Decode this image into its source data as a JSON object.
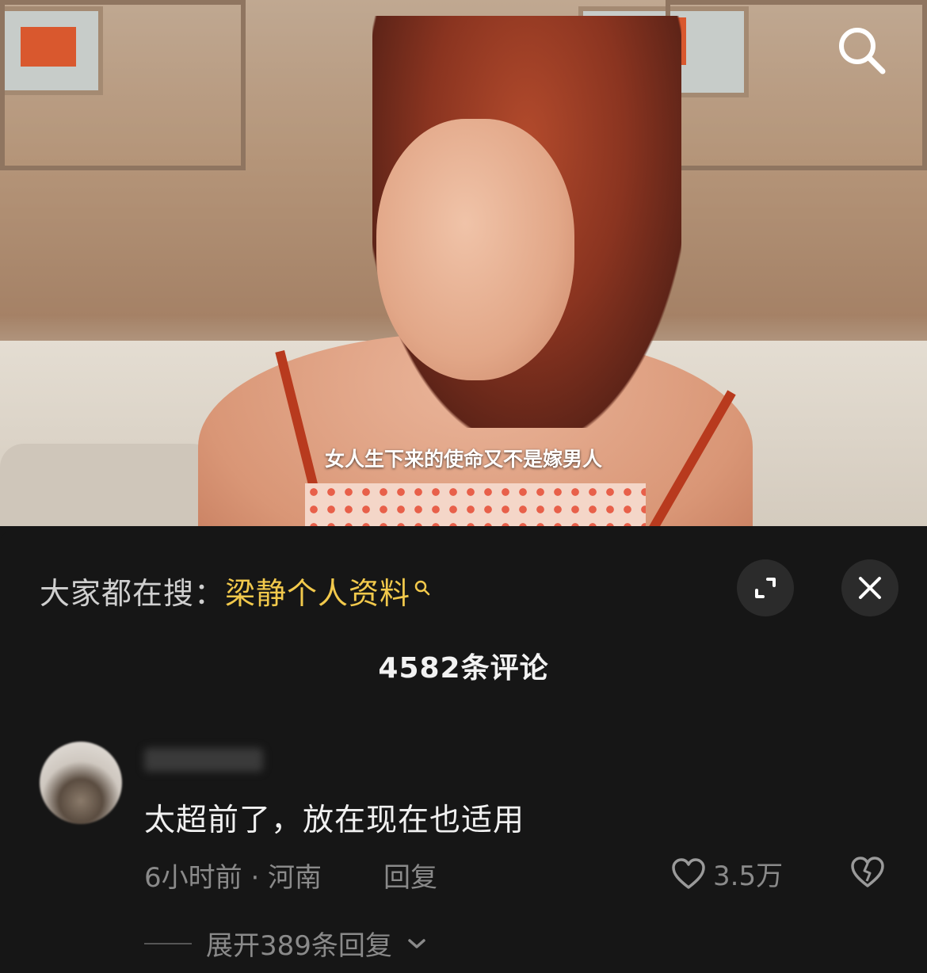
{
  "video": {
    "subtitle": "女人生下来的使命又不是嫁男人",
    "search_icon": "search-icon"
  },
  "sheet": {
    "search_hint": {
      "prefix": "大家都在搜：",
      "keyword": "梁静个人资料"
    },
    "fullscreen_icon": "expand-icon",
    "close_icon": "close-icon",
    "comment_count": "4582条评论",
    "comments": [
      {
        "text": "太超前了，放在现在也适用",
        "time_location": "6小时前 · 河南",
        "reply_label": "回复",
        "likes": "3.5万",
        "expand_label": "展开389条回复"
      }
    ]
  }
}
